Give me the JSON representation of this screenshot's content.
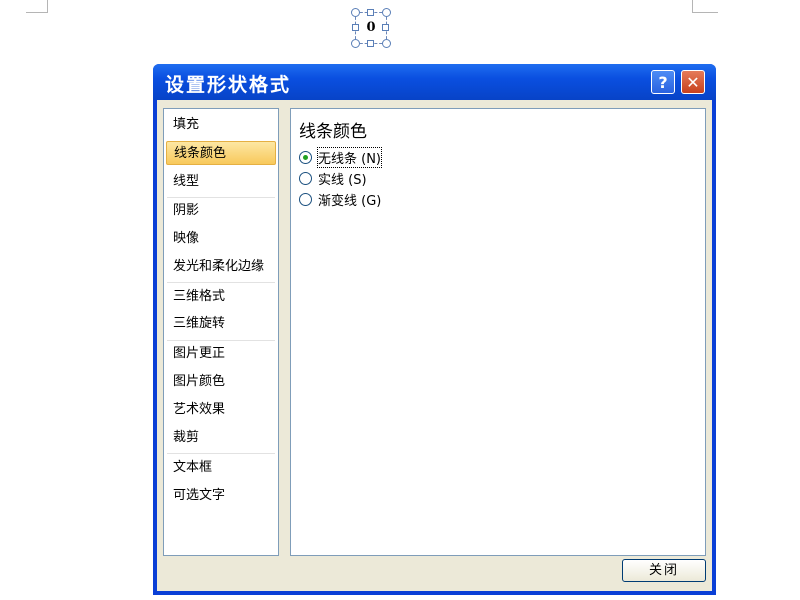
{
  "canvas": {
    "shape_text": "0"
  },
  "dialog": {
    "title": "设置形状格式",
    "help_symbol": "?",
    "close_symbol": "✕",
    "nav": [
      {
        "label": "填充"
      },
      {
        "label": "线条颜色"
      },
      {
        "label": "线型"
      },
      {
        "label": "阴影"
      },
      {
        "label": "映像"
      },
      {
        "label": "发光和柔化边缘"
      },
      {
        "label": "三维格式"
      },
      {
        "label": "三维旋转"
      },
      {
        "label": "图片更正"
      },
      {
        "label": "图片颜色"
      },
      {
        "label": "艺术效果"
      },
      {
        "label": "裁剪"
      },
      {
        "label": "文本框"
      },
      {
        "label": "可选文字"
      }
    ],
    "selected_nav": "线条颜色",
    "section": {
      "title": "线条颜色",
      "options": [
        {
          "label": "无线条 (N)",
          "checked": true
        },
        {
          "label": "实线 (S)",
          "checked": false
        },
        {
          "label": "渐变线 (G)",
          "checked": false
        }
      ]
    },
    "close_button": "关闭"
  }
}
